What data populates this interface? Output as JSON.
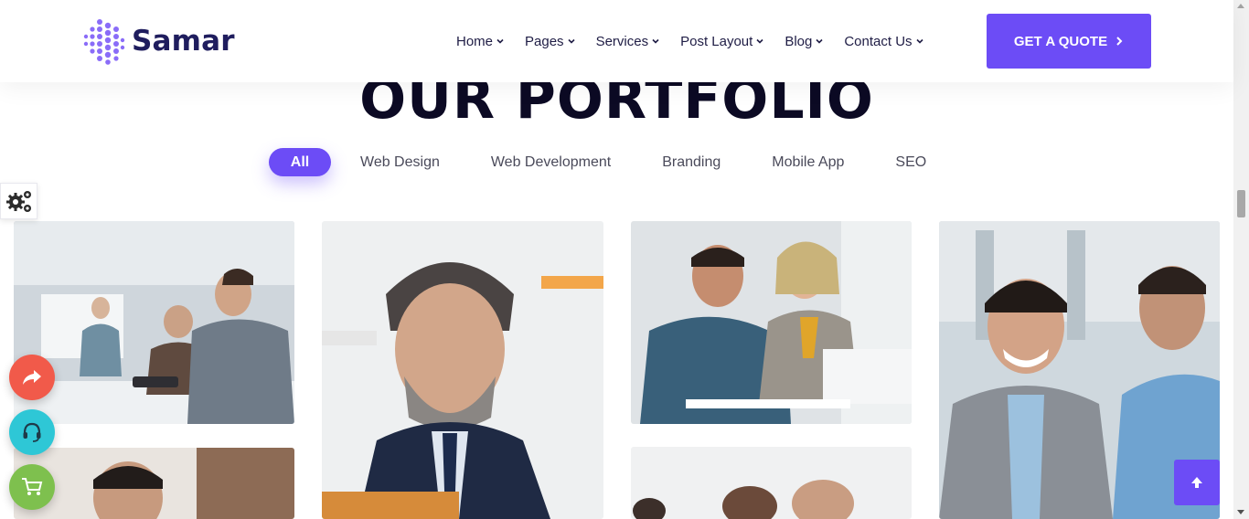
{
  "brand": {
    "name": "Samar",
    "accent": "#6c4cf6",
    "dark": "#1f1d5e"
  },
  "nav": {
    "items": [
      {
        "label": "Home"
      },
      {
        "label": "Pages"
      },
      {
        "label": "Services"
      },
      {
        "label": "Post Layout"
      },
      {
        "label": "Blog"
      },
      {
        "label": "Contact Us"
      }
    ],
    "cta_label": "GET A QUOTE"
  },
  "portfolio": {
    "title": "OUR PORTFOLIO",
    "filters": [
      {
        "label": "All",
        "active": true
      },
      {
        "label": "Web Design"
      },
      {
        "label": "Web Development"
      },
      {
        "label": "Branding"
      },
      {
        "label": "Mobile App"
      },
      {
        "label": "SEO"
      }
    ]
  },
  "floating_buttons": {
    "share": {
      "icon": "share-icon",
      "color": "#f15a4a"
    },
    "support": {
      "icon": "headset-icon",
      "color": "#2ec7d6"
    },
    "cart": {
      "icon": "cart-icon",
      "color": "#7ec04e"
    }
  },
  "icons": {
    "settings": "gears-icon",
    "back_to_top": "arrow-up-icon",
    "nav_caret": "chevron-down-icon",
    "cta_arrow": "chevron-right-icon"
  }
}
